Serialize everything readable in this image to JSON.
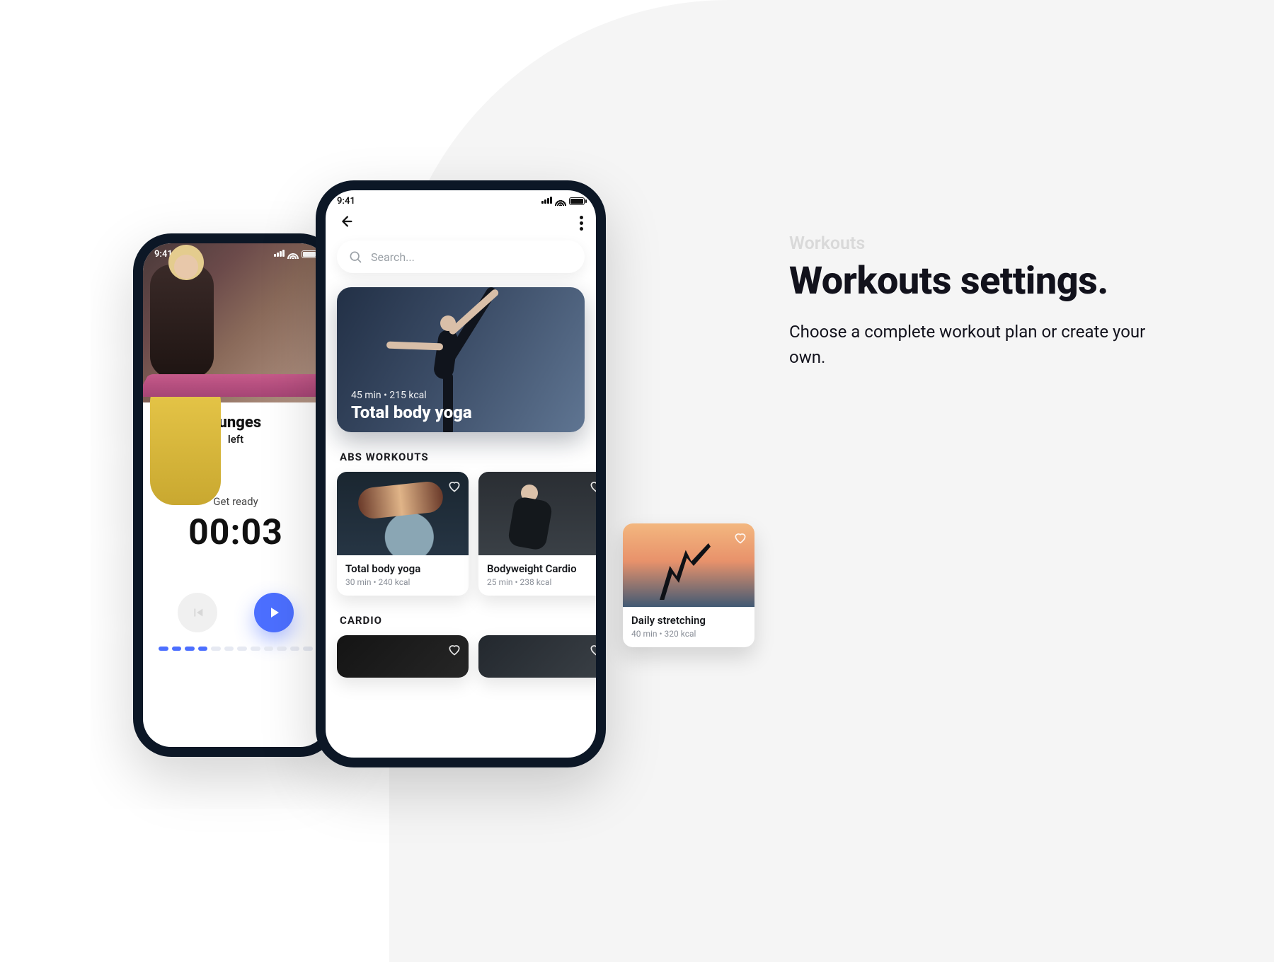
{
  "copy": {
    "kicker": "Workouts",
    "title": "Workouts settings.",
    "body": "Choose a complete workout plan or create your own."
  },
  "status": {
    "time": "9:41"
  },
  "phone_a": {
    "exercise_title": "Lunges",
    "exercise_side": "left",
    "ready_label": "Get ready",
    "timer": "00:03"
  },
  "phone_b": {
    "search_placeholder": "Search...",
    "feature": {
      "meta": "45 min • 215 kcal",
      "title": "Total body yoga"
    },
    "section_abs": "ABS WORKOUTS",
    "section_cardio": "CARDIO",
    "cards": [
      {
        "title": "Total body yoga",
        "sub": "30 min • 240 kcal"
      },
      {
        "title": "Bodyweight Cardio",
        "sub": "25 min • 238 kcal"
      },
      {
        "title": "Daily stretching",
        "sub": "40 min • 320 kcal"
      }
    ]
  }
}
